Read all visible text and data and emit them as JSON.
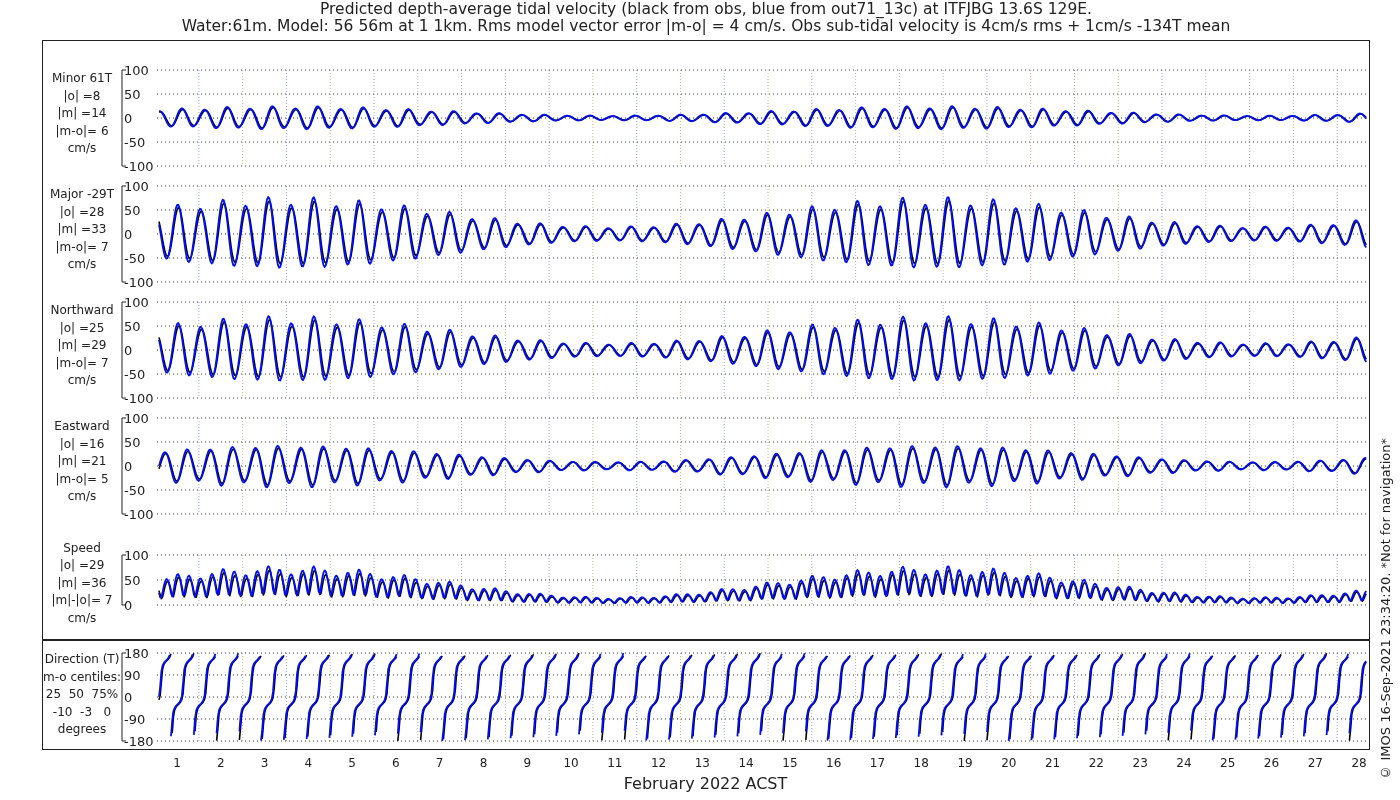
{
  "title": [
    "Predicted depth-average tidal velocity (black from obs, blue from out71_13c) at ITFJBG 13.6S 129E.",
    "Water:61m. Model: 56 56m at 1 1km. Rms model vector error |m-o| = 4 cm/s. Obs sub-tidal velocity is 4cm/s rms + 1cm/s -134T mean"
  ],
  "panels": [
    {
      "kind": "minor",
      "label_lines": [
        "Minor 61T",
        "|o| =8",
        "|m| =14",
        "|m-o|= 6",
        "cm/s"
      ],
      "yticks": [
        "100",
        "50",
        "0",
        "-50",
        "-100"
      ]
    },
    {
      "kind": "major",
      "label_lines": [
        "Major -29T",
        "|o| =28",
        "|m| =33",
        "|m-o|= 7",
        "cm/s"
      ],
      "yticks": [
        "100",
        "50",
        "0",
        "-50",
        "-100"
      ]
    },
    {
      "kind": "north",
      "label_lines": [
        "Northward",
        "|o| =25",
        "|m| =29",
        "|m-o|= 7",
        "cm/s"
      ],
      "yticks": [
        "100",
        "50",
        "0",
        "-50",
        "-100"
      ]
    },
    {
      "kind": "east",
      "label_lines": [
        "Eastward",
        "|o| =16",
        "|m| =21",
        "|m-o|= 5",
        "cm/s"
      ],
      "yticks": [
        "100",
        "50",
        "0",
        "-50",
        "-100"
      ]
    },
    {
      "kind": "speed",
      "label_lines": [
        "Speed",
        "|o| =29",
        "|m| =36",
        "|m|-|o|= 7",
        "cm/s"
      ],
      "yticks": [
        "100",
        "50",
        "0"
      ]
    },
    {
      "kind": "direction",
      "label_lines": [
        "Direction (T)",
        "m-o centiles:",
        "25  50  75%",
        "-10  -3   0",
        "degrees"
      ],
      "yticks": [
        "180",
        "90",
        "0",
        "-90",
        "-180"
      ]
    }
  ],
  "xaxis": {
    "ticks": [
      "1",
      "2",
      "3",
      "4",
      "5",
      "6",
      "7",
      "8",
      "9",
      "10",
      "11",
      "12",
      "13",
      "14",
      "15",
      "16",
      "17",
      "18",
      "19",
      "20",
      "21",
      "22",
      "23",
      "24",
      "25",
      "26",
      "27",
      "28"
    ],
    "label": "February 2022 ACST"
  },
  "credit": "© IMOS 16-Sep-2021 23:34:20. *Not for navigation*"
}
